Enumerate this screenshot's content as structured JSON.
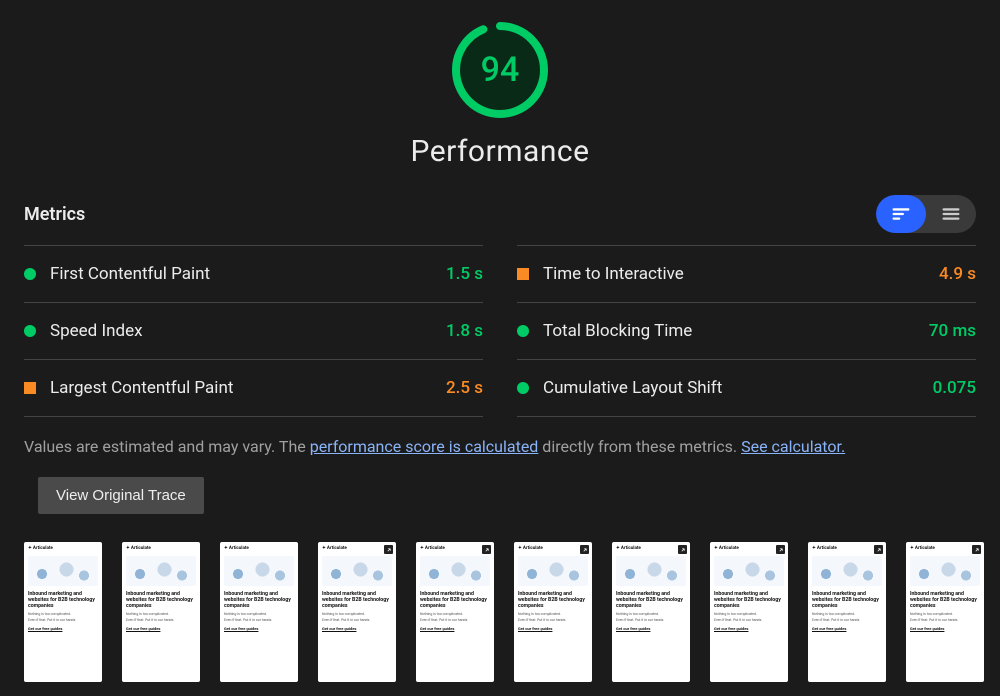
{
  "gauge": {
    "score": "94",
    "color": "#00cc66"
  },
  "title": "Performance",
  "metricsLabel": "Metrics",
  "metrics": {
    "left": [
      {
        "name": "First Contentful Paint",
        "value": "1.5 s",
        "status": "green",
        "label_key": "fcp"
      },
      {
        "name": "Speed Index",
        "value": "1.8 s",
        "status": "green",
        "label_key": "si"
      },
      {
        "name": "Largest Contentful Paint",
        "value": "2.5 s",
        "status": "orange",
        "label_key": "lcp"
      }
    ],
    "right": [
      {
        "name": "Time to Interactive",
        "value": "4.9 s",
        "status": "orange",
        "label_key": "tti"
      },
      {
        "name": "Total Blocking Time",
        "value": "70 ms",
        "status": "green",
        "label_key": "tbt"
      },
      {
        "name": "Cumulative Layout Shift",
        "value": "0.075",
        "status": "green",
        "label_key": "cls"
      }
    ]
  },
  "footnote": {
    "pre": "Values are estimated and may vary. The ",
    "link1": "performance score is calculated",
    "mid": " directly from these metrics. ",
    "link2": "See calculator."
  },
  "traceButton": "View Original Trace",
  "thumb": {
    "brand": "✦ Articulate",
    "headline": "Inbound marketing and websites for B2B technology companies",
    "sub1": "Nothing is too complicated.",
    "sub2": "Even if that. Put it in our hands.",
    "cta": "Get our free guides",
    "count": 10,
    "corner_from_index": 3
  }
}
